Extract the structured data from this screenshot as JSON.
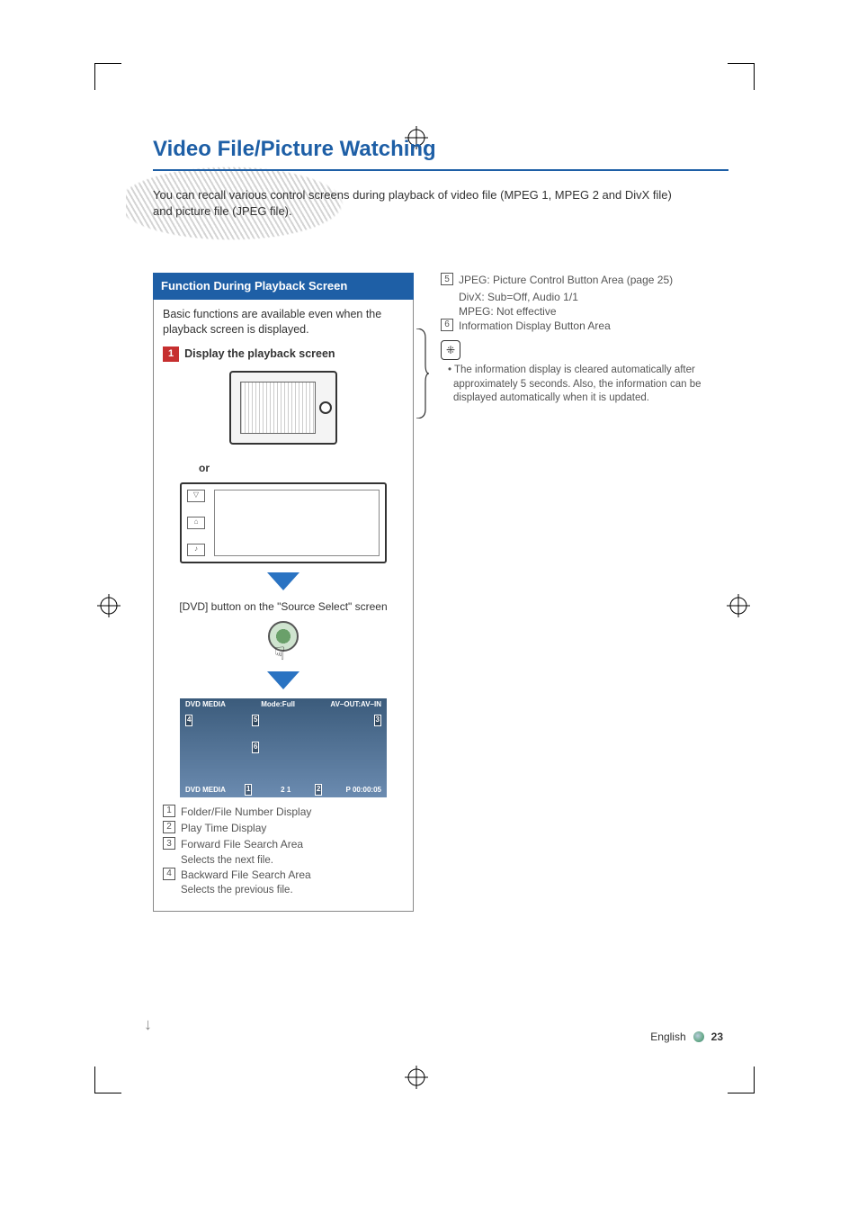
{
  "page": {
    "title": "Video File/Picture Watching",
    "intro": "You can recall various control screens during playback of video file (MPEG 1, MPEG 2 and DivX file) and picture file (JPEG file).",
    "footer_lang": "English",
    "footer_page": "23"
  },
  "function_box": {
    "header": "Function During Playback Screen",
    "body": "Basic functions are available even when the playback screen is displayed.",
    "step_num": "1",
    "step_text": "Display the playback screen",
    "or_label": "or",
    "select_caption": "[DVD] button on the \"Source Select\" screen"
  },
  "playback": {
    "top_left": "DVD MEDIA",
    "top_mid": "Mode:Full",
    "top_right": "AV–OUT:AV–IN",
    "bot_left": "DVD MEDIA",
    "bot_mid": "2      1",
    "bot_right": "P 00:00:05",
    "m1": "1",
    "m2": "2",
    "m3": "3",
    "m4": "4",
    "m5": "5",
    "m6": "6"
  },
  "legend": {
    "n1": "1",
    "t1": "Folder/File Number Display",
    "n2": "2",
    "t2": "Play Time Display",
    "n3": "3",
    "t3": "Forward File Search Area",
    "s3": "Selects the next file.",
    "n4": "4",
    "t4": "Backward File Search Area",
    "s4": "Selects the previous file."
  },
  "right": {
    "n5": "5",
    "l5a": "JPEG: Picture Control Button Area (page 25)",
    "l5b": "DivX:   Sub=Off, Audio 1/1",
    "l5c": "MPEG: Not effective",
    "n6": "6",
    "l6": "Information Display Button Area",
    "note": "The information display is cleared automatically after approximately 5 seconds. Also, the information can be displayed automatically when it is updated."
  }
}
